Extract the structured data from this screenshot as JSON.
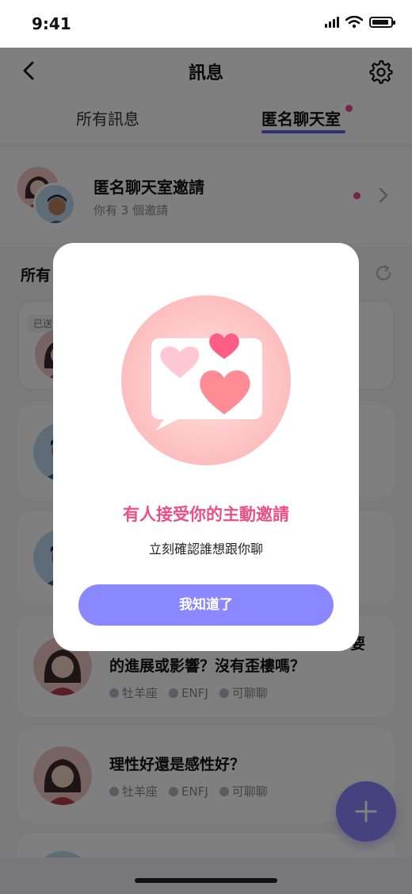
{
  "status_bar": {
    "time": "9:41"
  },
  "header": {
    "title": "訊息",
    "back_icon": "chevron-left-icon",
    "settings_icon": "gear-icon"
  },
  "tabs": [
    {
      "label": "所有訊息",
      "active": false
    },
    {
      "label": "匿名聊天室",
      "active": true,
      "has_badge": true
    }
  ],
  "invitation": {
    "title": "匿名聊天室邀請",
    "subtitle": "你有 3 個邀請"
  },
  "section": {
    "title": "所有",
    "refresh_icon": "refresh-icon"
  },
  "cards": [
    {
      "badge": "已送"
    },
    {
      "topic_lines": [
        "的進展或影響？沒有歪樓嗎？"
      ],
      "tags": [
        "牡羊座",
        "ENFJ",
        "可聊聊"
      ]
    },
    {
      "topic_lines": [
        "理性好還是感性好？"
      ],
      "tags": [
        "牡羊座",
        "ENFJ",
        "可聊聊"
      ]
    }
  ],
  "partial_text": {
    "card4_right_fragment": "要"
  },
  "fab": {
    "icon": "plus-icon"
  },
  "modal": {
    "title": "有人接受你的主動邀請",
    "subtitle": "立刻確認誰想跟你聊",
    "button_label": "我知道了"
  },
  "colors": {
    "accent": "#8b87ff",
    "tab_underline": "#6c5ce7",
    "highlight_pink": "#ec4f86",
    "badge_dot": "#e84a8a"
  }
}
